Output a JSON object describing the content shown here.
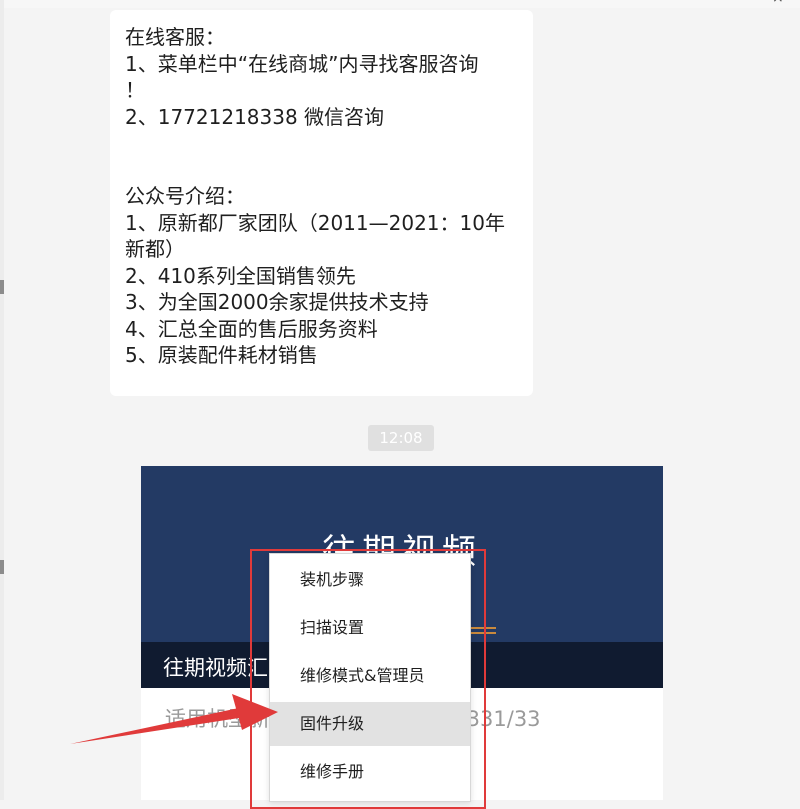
{
  "window": {
    "close_glyph": "×"
  },
  "message": {
    "text": "在线客服：\n1、菜单栏中“在线商城”内寻找客服咨询\n！\n2、17721218338 微信咨询\n\n\n公众号介绍：\n1、原新都厂家团队（2011—2021：10年\n新都）\n2、410系列全国销售领先\n3、为全国2000余家提供技术支持\n4、汇总全面的售后服务资料\n5、原装配件耗材销售"
  },
  "timestamp": "12:08",
  "article_card": {
    "cover_title": "往期视频",
    "caption": "往期视频汇",
    "description": "适用机型新 D310/D311/D330/331/33"
  },
  "context_menu": {
    "items": [
      {
        "label": "装机步骤",
        "highlighted": false
      },
      {
        "label": "扫描设置",
        "highlighted": false
      },
      {
        "label": "维修模式&管理员",
        "highlighted": false
      },
      {
        "label": "固件升级",
        "highlighted": true
      },
      {
        "label": "维修手册",
        "highlighted": false
      }
    ]
  },
  "colors": {
    "annotation": "#e03a3a",
    "cover_background": "#233a64",
    "menu_highlight": "#e2e2e2"
  }
}
